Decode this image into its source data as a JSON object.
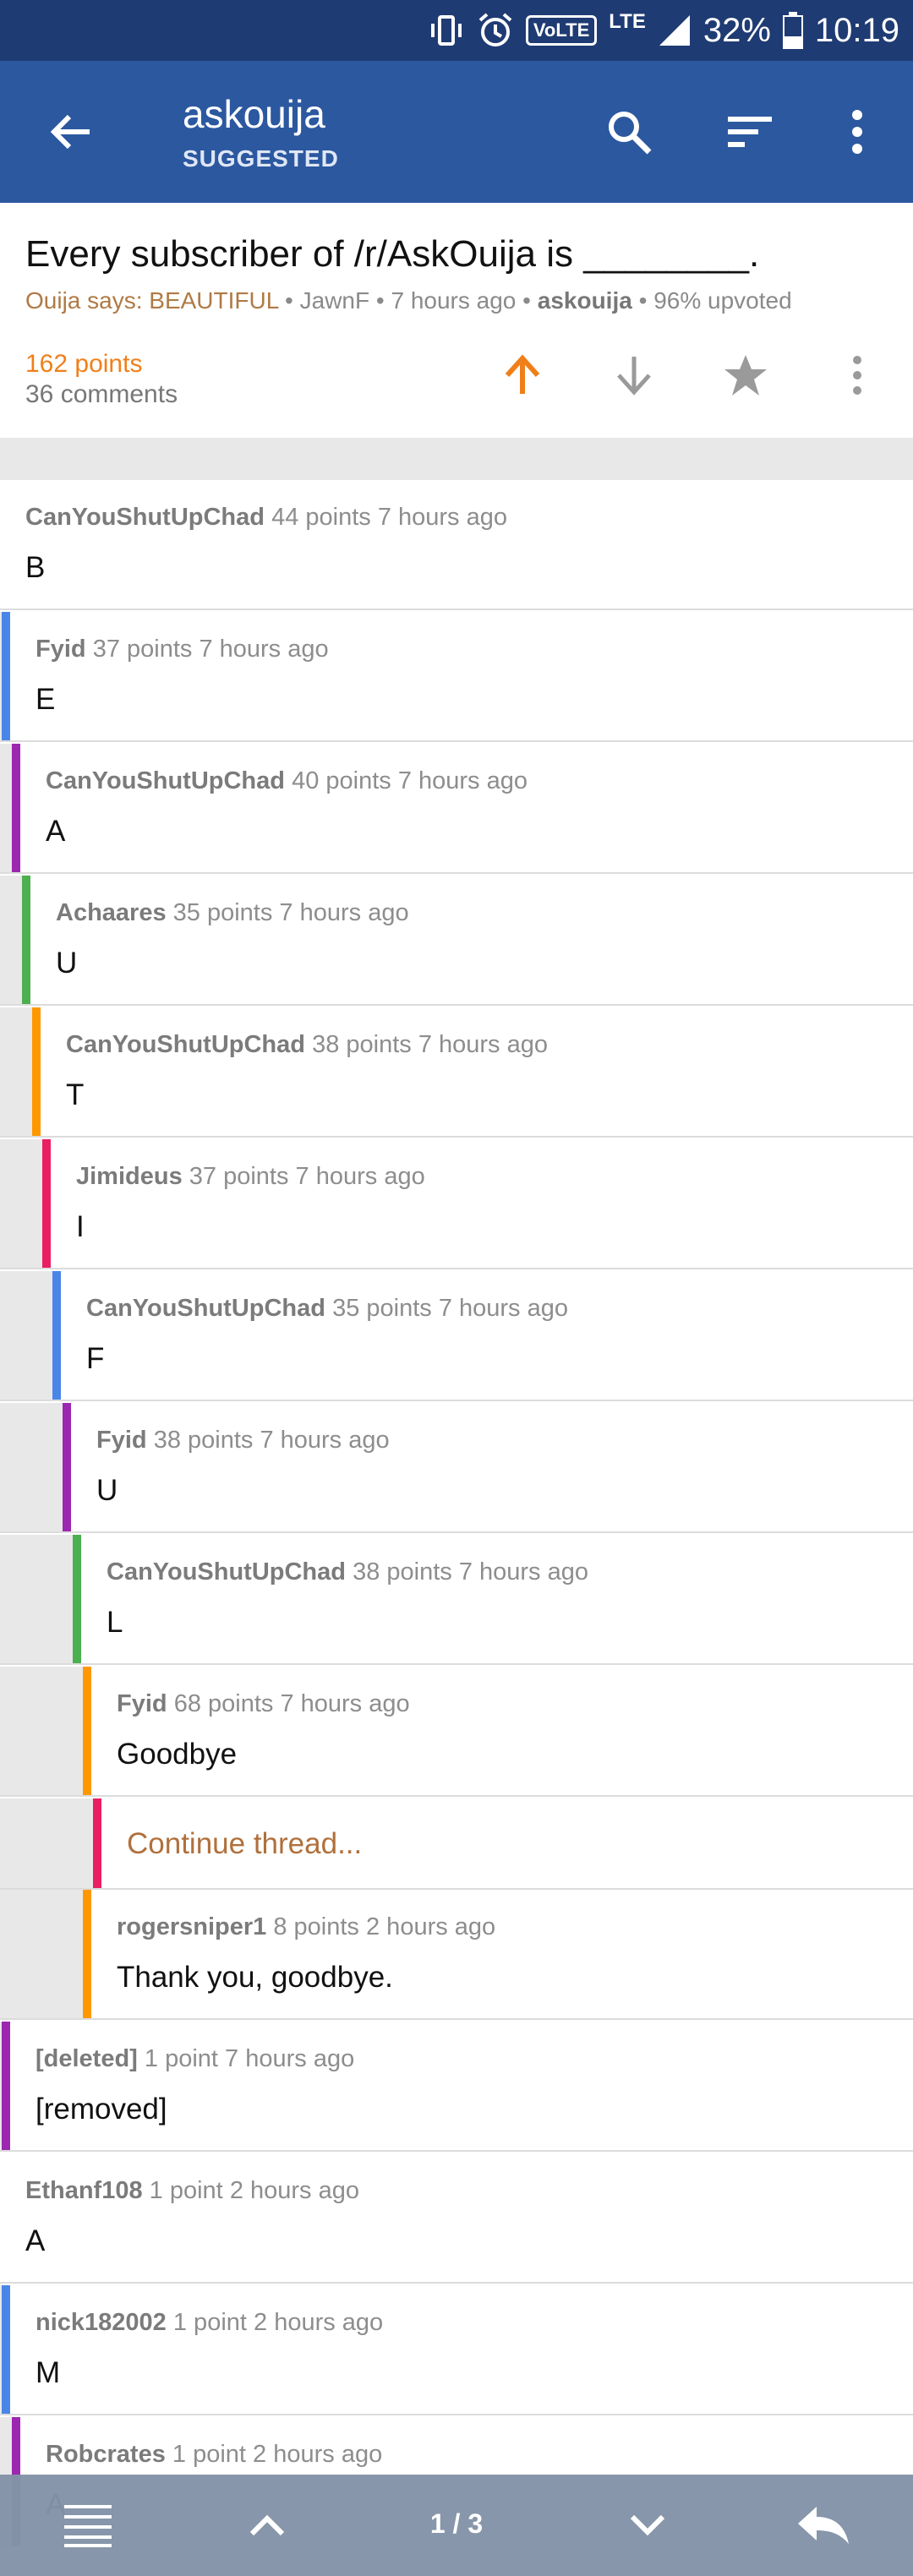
{
  "status_bar": {
    "battery": "32%",
    "time": "10:19",
    "volte": "VoLTE",
    "network": "LTE"
  },
  "app_bar": {
    "title": "askouija",
    "subtitle": "SUGGESTED"
  },
  "post": {
    "title": "Every subscriber of /r/AskOuija is ________.",
    "flair": "Ouija says: BEAUTIFUL",
    "author": "JawnF",
    "age": "7 hours ago",
    "subreddit": "askouija",
    "upvoted": "96% upvoted",
    "points": "162 points",
    "comments": "36 comments",
    "accent": "#f07f1a"
  },
  "comments": [
    {
      "author": "CanYouShutUpChad",
      "points": "44 points",
      "age": "7 hours ago",
      "body": "B"
    },
    {
      "author": "Fyid",
      "points": "37 points",
      "age": "7 hours ago",
      "body": "E"
    },
    {
      "author": "CanYouShutUpChad",
      "points": "40 points",
      "age": "7 hours ago",
      "body": "A"
    },
    {
      "author": "Achaares",
      "points": "35 points",
      "age": "7 hours ago",
      "body": "U"
    },
    {
      "author": "CanYouShutUpChad",
      "points": "38 points",
      "age": "7 hours ago",
      "body": "T"
    },
    {
      "author": "Jimideus",
      "points": "37 points",
      "age": "7 hours ago",
      "body": "I"
    },
    {
      "author": "CanYouShutUpChad",
      "points": "35 points",
      "age": "7 hours ago",
      "body": "F"
    },
    {
      "author": "Fyid",
      "points": "38 points",
      "age": "7 hours ago",
      "body": "U"
    },
    {
      "author": "CanYouShutUpChad",
      "points": "38 points",
      "age": "7 hours ago",
      "body": "L"
    },
    {
      "author": "Fyid",
      "points": "68 points",
      "age": "7 hours ago",
      "body": "Goodbye"
    },
    {
      "author": "rogersniper1",
      "points": "8 points",
      "age": "2 hours ago",
      "body": "Thank you, goodbye."
    },
    {
      "author": "[deleted]",
      "points": "1 point",
      "age": "7 hours ago",
      "body": "[removed]"
    },
    {
      "author": "Ethanf108",
      "points": "1 point",
      "age": "2 hours ago",
      "body": "A"
    },
    {
      "author": "nick182002",
      "points": "1 point",
      "age": "2 hours ago",
      "body": "M"
    },
    {
      "author": "Robcrates",
      "points": "1 point",
      "age": "2 hours ago",
      "body": "A"
    }
  ],
  "continue_thread": "Continue thread...",
  "depth_colors": [
    "#4a86e8",
    "#9c27b0",
    "#4caf50",
    "#ff9800",
    "#e91e63"
  ],
  "bottom_bar": {
    "page": "1 / 3"
  }
}
